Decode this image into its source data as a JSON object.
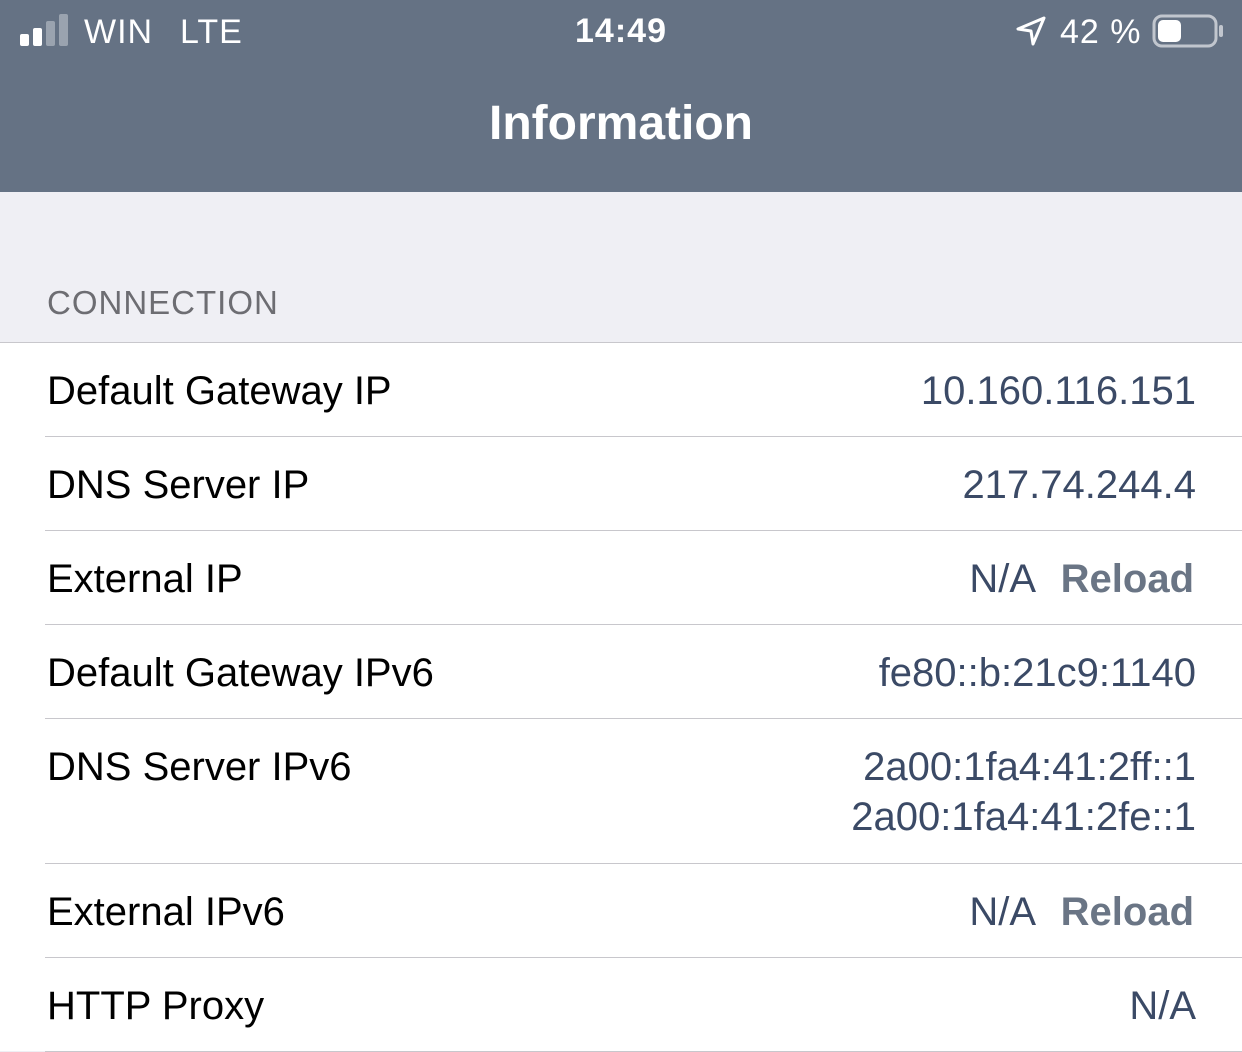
{
  "status_bar": {
    "carrier": "WIN",
    "network": "LTE",
    "time": "14:49",
    "battery_percent": "42 %",
    "signal_bars_filled": 2,
    "signal_bars_total": 4,
    "battery_level": 0.42,
    "icons": [
      "signal-icon",
      "location-arrow-icon",
      "battery-icon"
    ]
  },
  "nav": {
    "title": "Information"
  },
  "section": {
    "header": "CONNECTION"
  },
  "rows": [
    {
      "label": "Default Gateway IP",
      "value": "10.160.116.151"
    },
    {
      "label": "DNS Server IP",
      "value": "217.74.244.4"
    },
    {
      "label": "External IP",
      "value": "N/A",
      "action": "Reload"
    },
    {
      "label": "Default Gateway IPv6",
      "value": "fe80::b:21c9:1140"
    },
    {
      "label": "DNS Server IPv6",
      "value_lines": [
        "2a00:1fa4:41:2ff::1",
        "2a00:1fa4:41:2fe::1"
      ]
    },
    {
      "label": "External IPv6",
      "value": "N/A",
      "action": "Reload"
    },
    {
      "label": "HTTP Proxy",
      "value": "N/A"
    }
  ],
  "colors": {
    "nav_background": "#657284",
    "page_background": "#efeff4",
    "value_text": "#3b4a66",
    "action_text": "#6a7585",
    "separator": "#c8c7cc"
  }
}
